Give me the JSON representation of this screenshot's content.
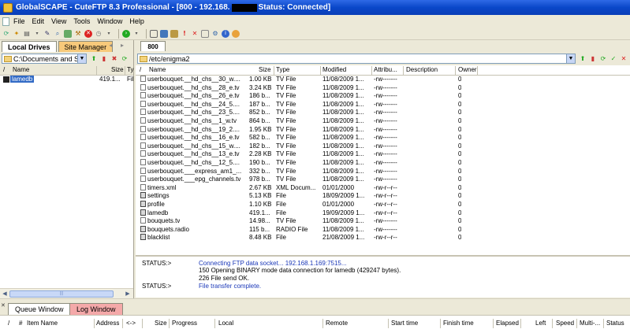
{
  "window": {
    "title_before": "GlobalSCAPE - CuteFTP 8.3 Professional - [800 - 192.168.",
    "title_after": "Status: Connected]"
  },
  "menu": [
    "File",
    "Edit",
    "View",
    "Tools",
    "Window",
    "Help"
  ],
  "left": {
    "tabs": [
      "Local Drives",
      "Site Manager"
    ],
    "path": "C:\\Documents and Set",
    "columns": [
      "/",
      "Name",
      "Size",
      "Ty"
    ],
    "rows": [
      {
        "name": "lamedb",
        "size": "419.1...",
        "type": "Fil"
      }
    ]
  },
  "right": {
    "tab": "800",
    "path": "/etc/enigma2",
    "columns": [
      "/",
      "Name",
      "Size",
      "Type",
      "Modified",
      "Attribu...",
      "Description",
      "Owner"
    ],
    "rows": [
      {
        "name": "userbouquet.__hd_chs__30_w....",
        "size": "1.00 KB",
        "type": "TV File",
        "modified": "11/08/2009 1...",
        "attr": "-rw-------",
        "owner": "0",
        "kind": "doc"
      },
      {
        "name": "userbouquet.__hd_chs__28_e.tv",
        "size": "3.24 KB",
        "type": "TV File",
        "modified": "11/08/2009 1...",
        "attr": "-rw-------",
        "owner": "0",
        "kind": "doc"
      },
      {
        "name": "userbouquet.__hd_chs__26_e.tv",
        "size": "186 b...",
        "type": "TV File",
        "modified": "11/08/2009 1...",
        "attr": "-rw-------",
        "owner": "0",
        "kind": "doc"
      },
      {
        "name": "userbouquet.__hd_chs__24_5....",
        "size": "187 b...",
        "type": "TV File",
        "modified": "11/08/2009 1...",
        "attr": "-rw-------",
        "owner": "0",
        "kind": "doc"
      },
      {
        "name": "userbouquet.__hd_chs__23_5....",
        "size": "852 b...",
        "type": "TV File",
        "modified": "11/08/2009 1...",
        "attr": "-rw-------",
        "owner": "0",
        "kind": "doc"
      },
      {
        "name": "userbouquet.__hd_chs__1_w.tv",
        "size": "864 b...",
        "type": "TV File",
        "modified": "11/08/2009 1...",
        "attr": "-rw-------",
        "owner": "0",
        "kind": "doc"
      },
      {
        "name": "userbouquet.__hd_chs__19_2....",
        "size": "1.95 KB",
        "type": "TV File",
        "modified": "11/08/2009 1...",
        "attr": "-rw-------",
        "owner": "0",
        "kind": "doc"
      },
      {
        "name": "userbouquet.__hd_chs__16_e.tv",
        "size": "582 b...",
        "type": "TV File",
        "modified": "11/08/2009 1...",
        "attr": "-rw-------",
        "owner": "0",
        "kind": "doc"
      },
      {
        "name": "userbouquet.__hd_chs__15_w....",
        "size": "182 b...",
        "type": "TV File",
        "modified": "11/08/2009 1...",
        "attr": "-rw-------",
        "owner": "0",
        "kind": "doc"
      },
      {
        "name": "userbouquet.__hd_chs__13_e.tv",
        "size": "2.28 KB",
        "type": "TV File",
        "modified": "11/08/2009 1...",
        "attr": "-rw-------",
        "owner": "0",
        "kind": "doc"
      },
      {
        "name": "userbouquet.__hd_chs__12_5....",
        "size": "190 b...",
        "type": "TV File",
        "modified": "11/08/2009 1...",
        "attr": "-rw-------",
        "owner": "0",
        "kind": "doc"
      },
      {
        "name": "userbouquet.___express_am1_...",
        "size": "332 b...",
        "type": "TV File",
        "modified": "11/08/2009 1...",
        "attr": "-rw-------",
        "owner": "0",
        "kind": "doc"
      },
      {
        "name": "userbouquet.___epg_channels.tv",
        "size": "978 b...",
        "type": "TV File",
        "modified": "11/08/2009 1...",
        "attr": "-rw-------",
        "owner": "0",
        "kind": "doc"
      },
      {
        "name": "timers.xml",
        "size": "2.67 KB",
        "type": "XML Docum...",
        "modified": "01/01/2000",
        "attr": "-rw-r--r--",
        "owner": "0",
        "kind": "doc"
      },
      {
        "name": "settings",
        "size": "5.13 KB",
        "type": "File",
        "modified": "18/09/2009 1...",
        "attr": "-rw-r--r--",
        "owner": "0",
        "kind": "sys"
      },
      {
        "name": "profile",
        "size": "1.10 KB",
        "type": "File",
        "modified": "01/01/2000",
        "attr": "-rw-r--r--",
        "owner": "0",
        "kind": "sys"
      },
      {
        "name": "lamedb",
        "size": "419.1...",
        "type": "File",
        "modified": "19/09/2009 1...",
        "attr": "-rw-r--r--",
        "owner": "0",
        "kind": "sys"
      },
      {
        "name": "bouquets.tv",
        "size": "14.98...",
        "type": "TV File",
        "modified": "11/08/2009 1...",
        "attr": "-rw-------",
        "owner": "0",
        "kind": "doc"
      },
      {
        "name": "bouquets.radio",
        "size": "115 b...",
        "type": "RADIO File",
        "modified": "11/08/2009 1...",
        "attr": "-rw-------",
        "owner": "0",
        "kind": "sys"
      },
      {
        "name": "blacklist",
        "size": "8.48 KB",
        "type": "File",
        "modified": "21/08/2009 1...",
        "attr": "-rw-r--r--",
        "owner": "0",
        "kind": "sys"
      }
    ]
  },
  "log": [
    {
      "label": "STATUS:>",
      "text": "Connecting FTP data socket... 192.168.1.169:7515...",
      "blue": true
    },
    {
      "label": "",
      "text": "150 Opening BINARY mode data connection for lamedb (429247 bytes).",
      "blue": false
    },
    {
      "label": "",
      "text": "226 File send OK.",
      "blue": false
    },
    {
      "label": "STATUS:>",
      "text": "File transfer complete.",
      "blue": true
    }
  ],
  "queue": {
    "tabs": [
      "Queue Window",
      "Log Window"
    ],
    "columns": [
      "/",
      "#",
      "Item Name",
      "Address",
      "<->",
      "Size",
      "Progress",
      "Local",
      "Remote",
      "Start time",
      "Finish time",
      "Elapsed",
      "Left",
      "Speed",
      "Multi-...",
      "Status"
    ]
  }
}
